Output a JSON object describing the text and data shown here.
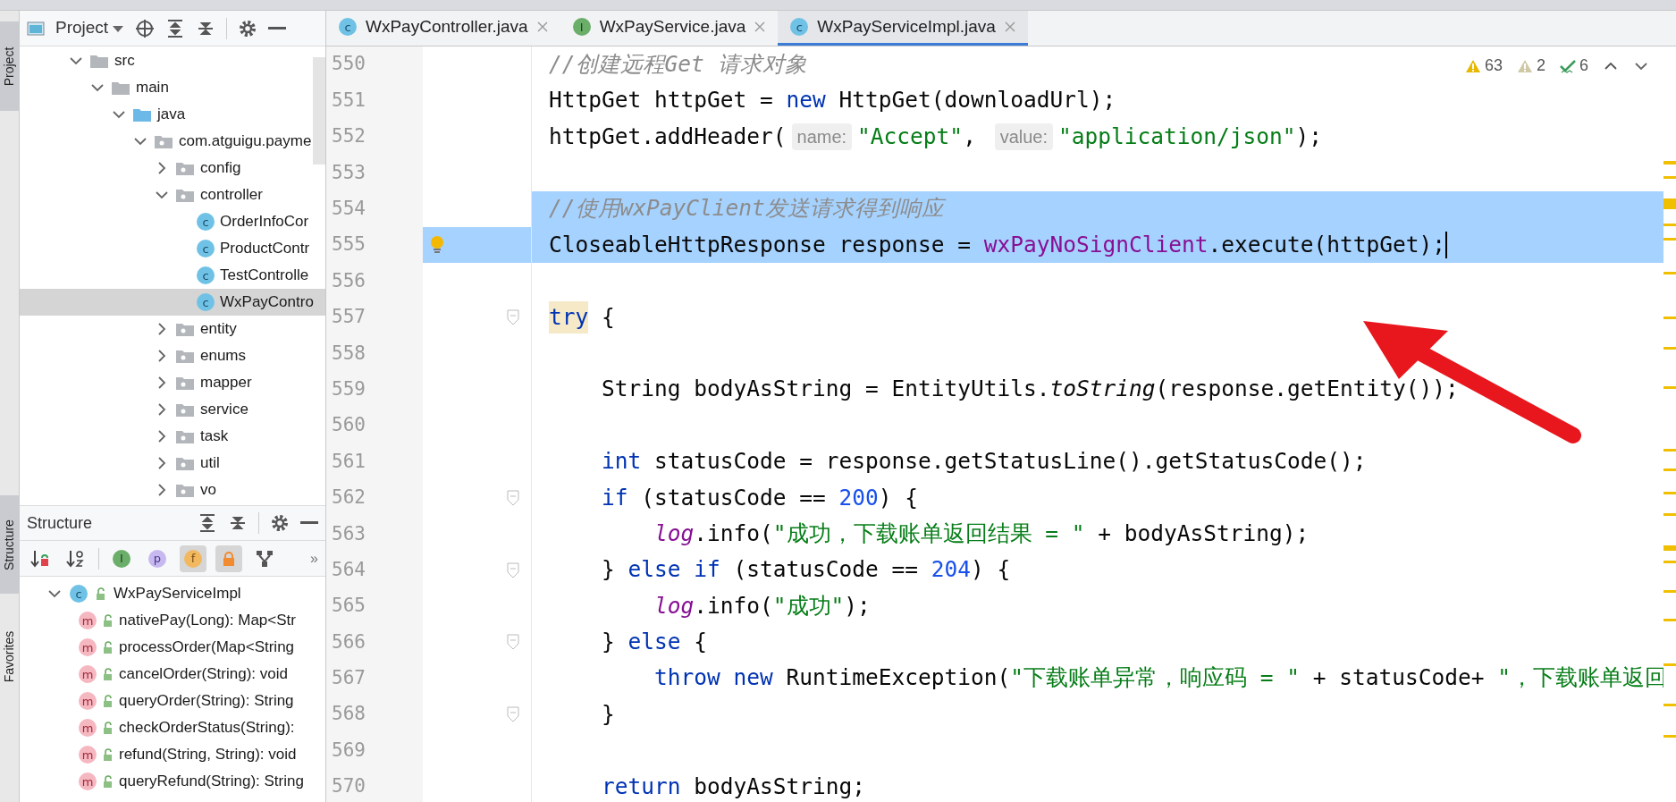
{
  "side_tabs": [
    {
      "label": "Project",
      "selected": true
    },
    {
      "label": "Structure",
      "selected": true
    },
    {
      "label": "Favorites",
      "selected": false
    }
  ],
  "project": {
    "title": "Project",
    "tree": [
      {
        "label": "src",
        "kind": "folder",
        "expanded": true,
        "children": [
          {
            "label": "main",
            "kind": "folder",
            "expanded": true,
            "children": [
              {
                "label": "java",
                "kind": "source-root",
                "expanded": true,
                "children": [
                  {
                    "label": "com.atguigu.payme",
                    "kind": "package",
                    "expanded": true,
                    "children": [
                      {
                        "label": "config",
                        "kind": "package",
                        "expanded": false
                      },
                      {
                        "label": "controller",
                        "kind": "package",
                        "expanded": true,
                        "children": [
                          {
                            "label": "OrderInfoCor",
                            "kind": "class",
                            "glyph": "c",
                            "selected": false
                          },
                          {
                            "label": "ProductContr",
                            "kind": "class",
                            "glyph": "c",
                            "selected": false
                          },
                          {
                            "label": "TestControlle",
                            "kind": "class",
                            "glyph": "c",
                            "selected": false
                          },
                          {
                            "label": "WxPayContro",
                            "kind": "class",
                            "glyph": "c",
                            "selected": true
                          }
                        ]
                      },
                      {
                        "label": "entity",
                        "kind": "package",
                        "expanded": false
                      },
                      {
                        "label": "enums",
                        "kind": "package",
                        "expanded": false
                      },
                      {
                        "label": "mapper",
                        "kind": "package",
                        "expanded": false
                      },
                      {
                        "label": "service",
                        "kind": "package",
                        "expanded": false
                      },
                      {
                        "label": "task",
                        "kind": "package",
                        "expanded": false
                      },
                      {
                        "label": "util",
                        "kind": "package",
                        "expanded": false
                      },
                      {
                        "label": "vo",
                        "kind": "package",
                        "expanded": false
                      }
                    ]
                  }
                ]
              }
            ]
          }
        ]
      }
    ]
  },
  "structure": {
    "title": "Structure",
    "toolbar": [
      {
        "kind": "sort-visibility",
        "on": false
      },
      {
        "kind": "sort-alpha",
        "on": false
      },
      {
        "kind": "inherited",
        "glyph": "I",
        "on": false
      },
      {
        "kind": "property",
        "glyph": "p",
        "on": false
      },
      {
        "kind": "field",
        "glyph": "f",
        "on": true
      },
      {
        "kind": "non-public",
        "on": true
      },
      {
        "kind": "lambda",
        "on": false
      }
    ],
    "overflow": "»",
    "root": {
      "label": "WxPayServiceImpl",
      "glyph": "c",
      "expanded": true,
      "children": [
        {
          "label": "nativePay(Long): Map<Str",
          "glyph": "m"
        },
        {
          "label": "processOrder(Map<String",
          "glyph": "m"
        },
        {
          "label": "cancelOrder(String): void",
          "glyph": "m"
        },
        {
          "label": "queryOrder(String): String",
          "glyph": "m"
        },
        {
          "label": "checkOrderStatus(String):",
          "glyph": "m"
        },
        {
          "label": "refund(String, String): void",
          "glyph": "m"
        },
        {
          "label": "queryRefund(String): String",
          "glyph": "m"
        }
      ]
    }
  },
  "editor": {
    "tabs": [
      {
        "label": "WxPayController.java",
        "glyph": "c",
        "kind": "class",
        "selected": false
      },
      {
        "label": "WxPayService.java",
        "glyph": "I",
        "kind": "interface",
        "selected": false
      },
      {
        "label": "WxPayServiceImpl.java",
        "glyph": "c",
        "kind": "class",
        "selected": true
      }
    ],
    "inspections": [
      {
        "kind": "warning",
        "count": "63"
      },
      {
        "kind": "weak-warning",
        "count": "2"
      },
      {
        "kind": "typo",
        "count": "6"
      }
    ],
    "lines": [
      {
        "number": "550",
        "tokens": [
          {
            "kind": "comment",
            "text": "//创建远程Get 请求对象"
          }
        ]
      },
      {
        "number": "551",
        "tokens": [
          {
            "kind": "plain",
            "text": "HttpGet httpGet = "
          },
          {
            "kind": "keyword",
            "text": "new"
          },
          {
            "kind": "plain",
            "text": " HttpGet(downloadUrl);"
          }
        ]
      },
      {
        "number": "552",
        "tokens": [
          {
            "kind": "plain",
            "text": "httpGet.addHeader("
          },
          {
            "kind": "hint",
            "text": "name:"
          },
          {
            "kind": "string",
            "text": "\"Accept\""
          },
          {
            "kind": "plain",
            "text": ", "
          },
          {
            "kind": "hint",
            "text": "value:"
          },
          {
            "kind": "string",
            "text": "\"application/json\""
          },
          {
            "kind": "plain",
            "text": ");"
          }
        ]
      },
      {
        "number": "553"
      },
      {
        "number": "554",
        "selected": true,
        "tokens": [
          {
            "kind": "comment",
            "text": "//使用wxPayClient发送请求得到响应"
          }
        ]
      },
      {
        "number": "555",
        "selected": true,
        "bulb": true,
        "caret": true,
        "tokens": [
          {
            "kind": "plain",
            "text": "CloseableHttpResponse response = "
          },
          {
            "kind": "member",
            "text": "wxPayNoSignClient"
          },
          {
            "kind": "plain",
            "text": ".execute(httpGet);"
          }
        ]
      },
      {
        "number": "556"
      },
      {
        "number": "557",
        "fold": true,
        "tokens": [
          {
            "kind": "keyword",
            "text": "try",
            "highlighted": true
          },
          {
            "kind": "plain",
            "text": " {"
          }
        ]
      },
      {
        "number": "558"
      },
      {
        "number": "559",
        "tokens": [
          {
            "kind": "plain",
            "text": "    String bodyAsString = EntityUtils."
          },
          {
            "kind": "static",
            "text": "toString"
          },
          {
            "kind": "plain",
            "text": "(response.getEntity());"
          }
        ]
      },
      {
        "number": "560"
      },
      {
        "number": "561",
        "tokens": [
          {
            "kind": "keyword",
            "text": "    int"
          },
          {
            "kind": "plain",
            "text": " statusCode = response.getStatusLine().getStatusCode();"
          }
        ]
      },
      {
        "number": "562",
        "fold": true,
        "tokens": [
          {
            "kind": "keyword",
            "text": "    if"
          },
          {
            "kind": "plain",
            "text": " (statusCode == "
          },
          {
            "kind": "number",
            "text": "200"
          },
          {
            "kind": "plain",
            "text": ") {"
          }
        ]
      },
      {
        "number": "563",
        "tokens": [
          {
            "kind": "log",
            "text": "        log"
          },
          {
            "kind": "plain",
            "text": ".info("
          },
          {
            "kind": "string",
            "text": "\"成功，下载账单返回结果 = \""
          },
          {
            "kind": "plain",
            "text": " + bodyAsString);"
          }
        ]
      },
      {
        "number": "564",
        "fold": true,
        "tokens": [
          {
            "kind": "plain",
            "text": "    } "
          },
          {
            "kind": "keyword",
            "text": "else if"
          },
          {
            "kind": "plain",
            "text": " (statusCode == "
          },
          {
            "kind": "number",
            "text": "204"
          },
          {
            "kind": "plain",
            "text": ") {"
          }
        ]
      },
      {
        "number": "565",
        "tokens": [
          {
            "kind": "log",
            "text": "        log"
          },
          {
            "kind": "plain",
            "text": ".info("
          },
          {
            "kind": "string",
            "text": "\"成功\""
          },
          {
            "kind": "plain",
            "text": ");"
          }
        ]
      },
      {
        "number": "566",
        "fold": true,
        "tokens": [
          {
            "kind": "plain",
            "text": "    } "
          },
          {
            "kind": "keyword",
            "text": "else"
          },
          {
            "kind": "plain",
            "text": " {"
          }
        ]
      },
      {
        "number": "567",
        "tokens": [
          {
            "kind": "keyword",
            "text": "        throw new"
          },
          {
            "kind": "plain",
            "text": " RuntimeException("
          },
          {
            "kind": "string",
            "text": "\"下载账单异常，响应码 = \""
          },
          {
            "kind": "plain",
            "text": " + statusCode+ "
          },
          {
            "kind": "string",
            "text": "\"，下载账单返回"
          }
        ]
      },
      {
        "number": "568",
        "fold": true,
        "tokens": [
          {
            "kind": "plain",
            "text": "    }"
          }
        ]
      },
      {
        "number": "569"
      },
      {
        "number": "570",
        "tokens": [
          {
            "kind": "keyword",
            "text": "    return"
          },
          {
            "kind": "plain",
            "text": " bodyAsString;"
          }
        ]
      }
    ]
  }
}
